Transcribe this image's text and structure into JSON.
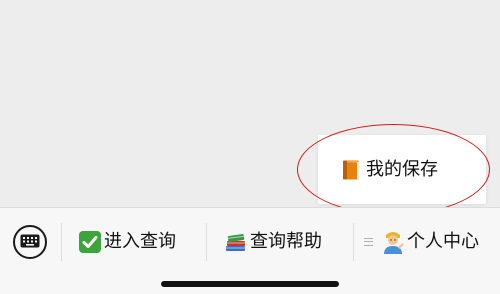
{
  "popup": {
    "items": [
      {
        "label": "我的保存",
        "icon": "book-icon"
      }
    ]
  },
  "menu": {
    "keyboard_icon": "keyboard-icon",
    "items": [
      {
        "label": "进入查询",
        "icon": "check-mark-button-icon"
      },
      {
        "label": "查询帮助",
        "icon": "books-icon"
      },
      {
        "label": "个人中心",
        "icon": "person-tipping-hand-icon",
        "submenu_icon": "submenu-lines-icon"
      }
    ]
  },
  "colors": {
    "background": "#ededed",
    "menu_bar": "#f7f7f7",
    "popup": "#ffffff",
    "highlight": "#d01b1b",
    "check_green": "#3aa53a"
  }
}
